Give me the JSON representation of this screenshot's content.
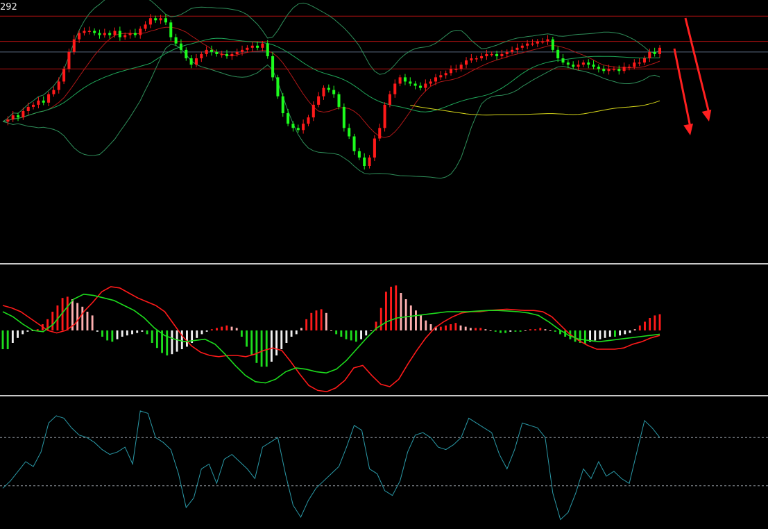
{
  "price_label": "292",
  "colors": {
    "background": "#000000",
    "candle_up": "#ff1a1a",
    "candle_down": "#1dfc1d",
    "bollinger": "#2f8f5a",
    "ma_fast": "#b01818",
    "ma_mid": "#1fa85a",
    "ma_long": "#d8d81a",
    "hline": "#b01010",
    "hline_grey": "#5a6a80",
    "macd_line": "#ff1a1a",
    "signal_line": "#1ddc1d",
    "hist_up": "#ff1a1a",
    "hist_up_light": "#ffb0b0",
    "hist_down": "#1ddc1d",
    "hist_down_light": "#f0f0f0",
    "osc": "#2a9aa8",
    "panel_divider": "#c8c8c8",
    "arrow": "#ff2020"
  },
  "chart_data": [
    {
      "type": "candlestick",
      "panel": "price",
      "ylim": [
        0,
        100
      ],
      "close_path": [
        45,
        46,
        48,
        47,
        50,
        52,
        53,
        55,
        54,
        58,
        60,
        64,
        70,
        78,
        84,
        87,
        88,
        88,
        87,
        86,
        87,
        86,
        88,
        85,
        86,
        87,
        86,
        89,
        91,
        94,
        93,
        94,
        92,
        85,
        82,
        79,
        75,
        72,
        75,
        77,
        79,
        78,
        77,
        77,
        76,
        77,
        78,
        79,
        80,
        81,
        80,
        82,
        76,
        66,
        57,
        49,
        44,
        42,
        41,
        44,
        47,
        53,
        57,
        61,
        60,
        58,
        52,
        42,
        38,
        31,
        28,
        24,
        28,
        37,
        42,
        53,
        58,
        63,
        66,
        64,
        63,
        62,
        61,
        63,
        64,
        66,
        67,
        68,
        70,
        70,
        72,
        74,
        75,
        75,
        76,
        77,
        77,
        76,
        77,
        78,
        79,
        80,
        81,
        82,
        82,
        83,
        83,
        84,
        79,
        75,
        73,
        72,
        71,
        72,
        73,
        72,
        71,
        70,
        69,
        70,
        70,
        69,
        71,
        71,
        73,
        73,
        75,
        78,
        77,
        80
      ],
      "horizontal_levels": [
        95,
        83,
        78,
        70
      ],
      "indicators": [
        "Bollinger Bands",
        "MA",
        "MA",
        "MA"
      ]
    },
    {
      "type": "macd",
      "panel": "macd",
      "ylim": [
        -100,
        100
      ],
      "histogram": [
        -30,
        -30,
        -20,
        -12,
        -6,
        -2,
        0,
        2,
        10,
        18,
        30,
        40,
        52,
        54,
        50,
        44,
        38,
        30,
        24,
        -2,
        -10,
        -16,
        -18,
        -14,
        -10,
        -8,
        -6,
        -4,
        -2,
        -6,
        -20,
        -28,
        -36,
        -40,
        -38,
        -34,
        -30,
        -26,
        -20,
        -12,
        -6,
        -2,
        2,
        4,
        6,
        8,
        6,
        4,
        -10,
        -26,
        -40,
        -52,
        -58,
        -58,
        -50,
        -40,
        -30,
        -20,
        -10,
        -6,
        4,
        18,
        28,
        32,
        34,
        28,
        0,
        -6,
        -10,
        -14,
        -16,
        -18,
        -14,
        -8,
        0,
        14,
        36,
        62,
        70,
        72,
        60,
        50,
        40,
        32,
        24,
        16,
        10,
        6,
        6,
        8,
        10,
        12,
        8,
        6,
        4,
        4,
        4,
        2,
        0,
        -2,
        -4,
        -4,
        -2,
        -2,
        -2,
        0,
        2,
        2,
        4,
        2,
        0,
        -2,
        -6,
        -10,
        -14,
        -18,
        -20,
        -22,
        -18,
        -16,
        -14,
        -12,
        -10,
        -10,
        -8,
        -6,
        -4,
        2,
        8,
        14,
        20,
        24,
        26
      ],
      "macd": [
        40,
        36,
        30,
        20,
        10,
        0,
        -4,
        0,
        10,
        30,
        45,
        62,
        70,
        68,
        60,
        52,
        46,
        40,
        30,
        10,
        -10,
        -25,
        -35,
        -40,
        -42,
        -40,
        -40,
        -42,
        -38,
        -32,
        -28,
        -32,
        -50,
        -70,
        -88,
        -96,
        -98,
        -92,
        -80,
        -60,
        -56,
        -72,
        -86,
        -90,
        -78,
        -54,
        -32,
        -12,
        4,
        14,
        22,
        28,
        30,
        30,
        32,
        33,
        34,
        33,
        32,
        32,
        30,
        22,
        8,
        -6,
        -16,
        -24,
        -30,
        -30,
        -30,
        -28,
        -22,
        -18,
        -12,
        -8
      ],
      "signal": [
        30,
        22,
        10,
        0,
        -2,
        10,
        30,
        50,
        58,
        56,
        52,
        48,
        40,
        32,
        20,
        4,
        -8,
        -14,
        -18,
        -16,
        -14,
        -22,
        -38,
        -56,
        -72,
        -82,
        -84,
        -78,
        -66,
        -60,
        -62,
        -66,
        -68,
        -62,
        -48,
        -30,
        -12,
        4,
        14,
        20,
        22,
        24,
        26,
        28,
        30,
        30,
        30,
        31,
        32,
        32,
        31,
        30,
        28,
        24,
        14,
        2,
        -8,
        -14,
        -16,
        -18,
        -16,
        -14,
        -12,
        -10,
        -8,
        -6
      ]
    },
    {
      "type": "line",
      "panel": "oscillator",
      "ylim": [
        0,
        100
      ],
      "reference_levels": [
        70,
        30
      ],
      "values": [
        28,
        34,
        42,
        50,
        46,
        58,
        82,
        88,
        86,
        78,
        72,
        70,
        66,
        60,
        56,
        58,
        62,
        48,
        92,
        90,
        70,
        66,
        60,
        40,
        12,
        20,
        44,
        48,
        32,
        52,
        56,
        50,
        44,
        36,
        62,
        66,
        70,
        40,
        14,
        4,
        18,
        28,
        34,
        40,
        46,
        62,
        80,
        76,
        44,
        40,
        26,
        22,
        34,
        58,
        72,
        74,
        70,
        62,
        60,
        64,
        70,
        86,
        82,
        78,
        74,
        56,
        44,
        60,
        82,
        80,
        78,
        70,
        24,
        2,
        8,
        24,
        44,
        36,
        50,
        38,
        42,
        36,
        32,
        58,
        84,
        78,
        70
      ],
      "note": ""
    }
  ],
  "arrows": [
    {
      "direction": "down"
    },
    {
      "direction": "down"
    }
  ]
}
